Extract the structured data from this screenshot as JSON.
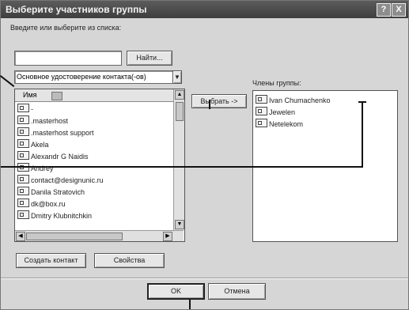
{
  "dialog": {
    "title": "Выберите участников группы",
    "help_label": "?",
    "close_label": "X"
  },
  "search": {
    "label": "Введите или выберите из списка:",
    "value": "",
    "find_button": "Найти..."
  },
  "address_book": {
    "selected": "Основное удостоверение контакта(-ов)"
  },
  "contacts": {
    "header": "Имя",
    "items": [
      "-",
      ".masterhost",
      ".masterhost support",
      "Akela",
      "Alexandr G Naidis",
      "Andrey",
      "contact@designunic.ru",
      "Danila Stratovich",
      "dk@box.ru",
      "Dmitry Klubnitchkin"
    ]
  },
  "select_button": "Выбрать ->",
  "members": {
    "label": "Члены группы:",
    "items": [
      "Ivan Chumachenko",
      "Jewelen",
      "Netelekom"
    ]
  },
  "actions": {
    "new_contact": "Создать контакт",
    "properties": "Свойства",
    "ok": "OK",
    "cancel": "Отмена"
  }
}
